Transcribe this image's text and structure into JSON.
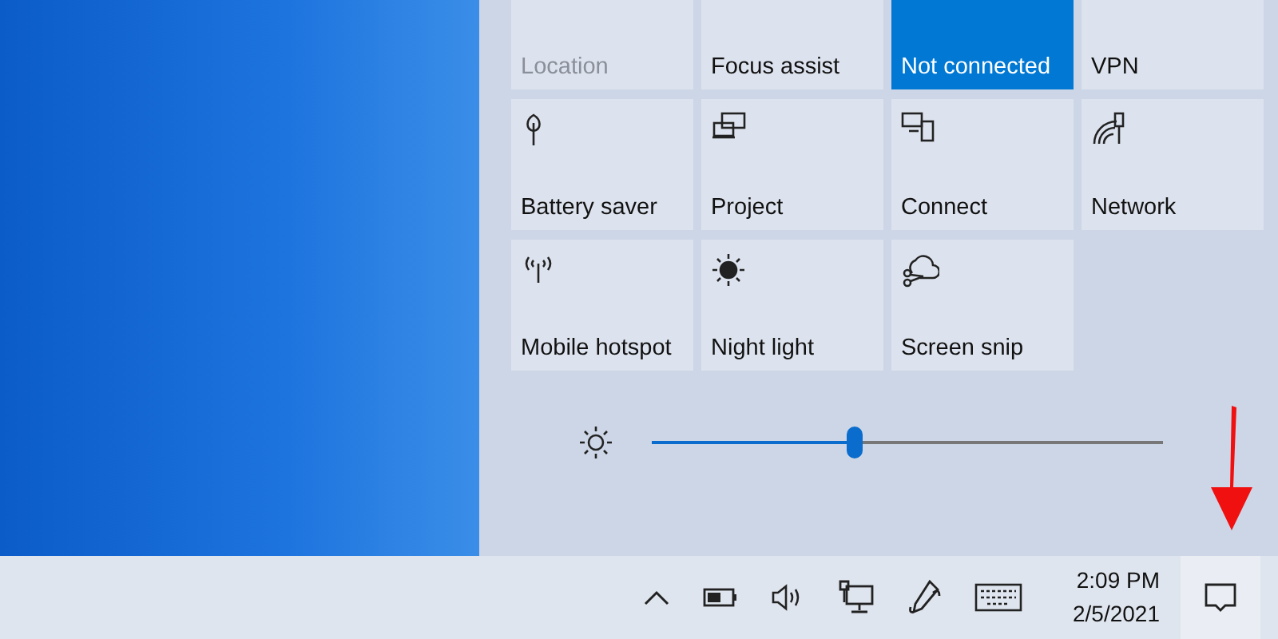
{
  "quick_actions": [
    {
      "label": "Location",
      "on": false,
      "disabled": true
    },
    {
      "label": "Focus assist",
      "on": false,
      "disabled": false
    },
    {
      "label": "Not connected",
      "on": true,
      "disabled": false
    },
    {
      "label": "VPN",
      "on": false,
      "disabled": false
    },
    {
      "label": "Battery saver",
      "on": false,
      "disabled": false
    },
    {
      "label": "Project",
      "on": false,
      "disabled": false
    },
    {
      "label": "Connect",
      "on": false,
      "disabled": false
    },
    {
      "label": "Network",
      "on": false,
      "disabled": false
    },
    {
      "label": "Mobile hotspot",
      "on": false,
      "disabled": false
    },
    {
      "label": "Night light",
      "on": false,
      "disabled": false
    },
    {
      "label": "Screen snip",
      "on": false,
      "disabled": false
    }
  ],
  "brightness": {
    "level": 0.4
  },
  "taskbar": {
    "time": "2:09 PM",
    "date": "2/5/2021"
  }
}
